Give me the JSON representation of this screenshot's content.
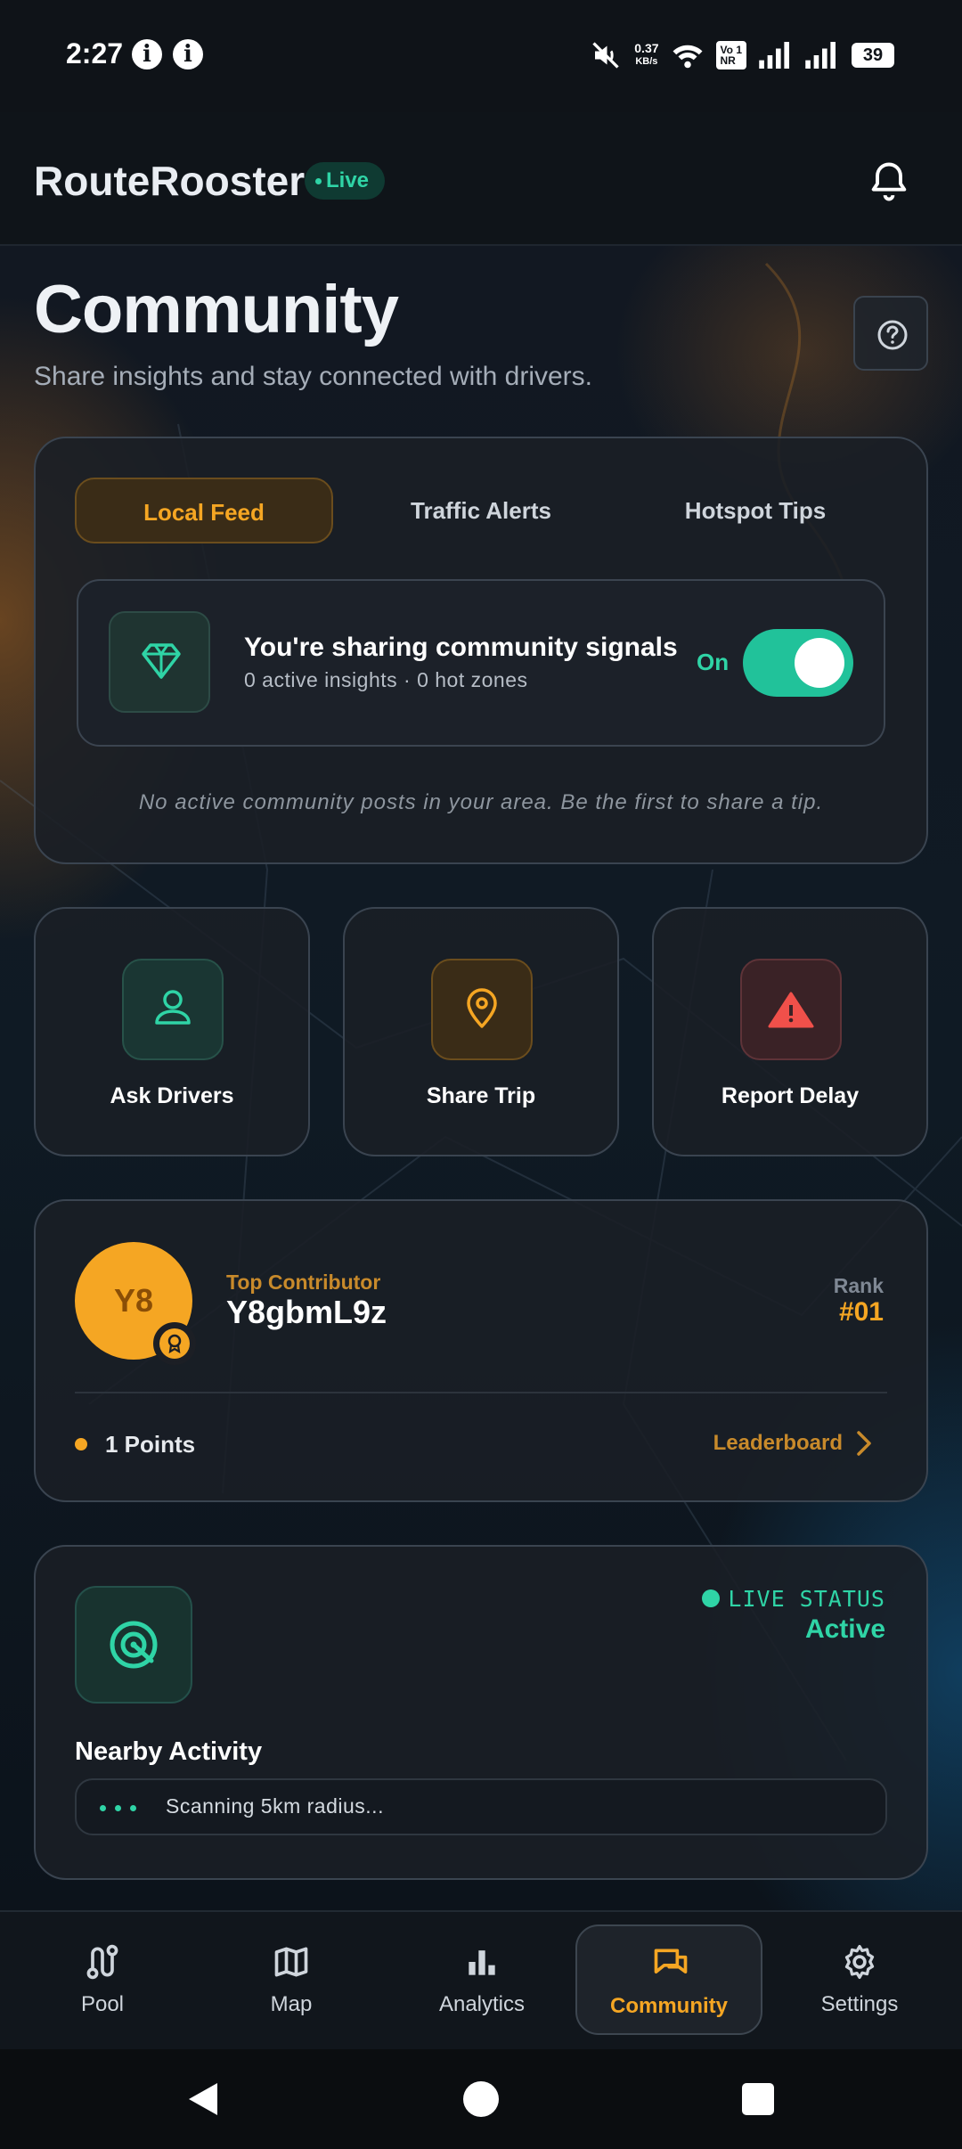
{
  "status_bar": {
    "time": "2:27",
    "net_speed_value": "0.37",
    "net_speed_unit": "KB/s",
    "volte_top": "Vo",
    "volte_bottom": "NR",
    "volte_sim": "1",
    "battery": "39"
  },
  "header": {
    "app_name": "RouteRooster",
    "live_label": "Live"
  },
  "page": {
    "title": "Community",
    "subtitle": "Share insights and stay connected with drivers."
  },
  "tabs": [
    {
      "label": "Local Feed",
      "active": true
    },
    {
      "label": "Traffic Alerts",
      "active": false
    },
    {
      "label": "Hotspot Tips",
      "active": false
    }
  ],
  "sharing": {
    "title": "You're sharing community signals",
    "subtitle": "0 active insights · 0 hot zones",
    "toggle_label": "On",
    "toggle_on": true
  },
  "empty_note": "No active community posts in your area. Be the first to share a tip.",
  "actions": [
    {
      "label": "Ask Drivers",
      "icon": "user-icon"
    },
    {
      "label": "Share Trip",
      "icon": "map-pin-icon"
    },
    {
      "label": "Report Delay",
      "icon": "warning-icon"
    }
  ],
  "contributor": {
    "initials": "Y8",
    "label": "Top Contributor",
    "name": "Y8gbmL9z",
    "rank_label": "Rank",
    "rank_value": "#01",
    "points": "1 Points",
    "leaderboard_label": "Leaderboard"
  },
  "nearby": {
    "status_label": "LIVE STATUS",
    "status_value": "Active",
    "title": "Nearby Activity",
    "scan_text": "Scanning 5km radius..."
  },
  "nav": [
    {
      "label": "Pool",
      "icon": "route-icon",
      "active": false
    },
    {
      "label": "Map",
      "icon": "map-icon",
      "active": false
    },
    {
      "label": "Analytics",
      "icon": "bar-chart-icon",
      "active": false
    },
    {
      "label": "Community",
      "icon": "chat-icon",
      "active": true
    },
    {
      "label": "Settings",
      "icon": "gear-icon",
      "active": false
    }
  ],
  "colors": {
    "accent_orange": "#f5a623",
    "accent_teal": "#2fd4a6",
    "alert_red": "#f0504a"
  }
}
